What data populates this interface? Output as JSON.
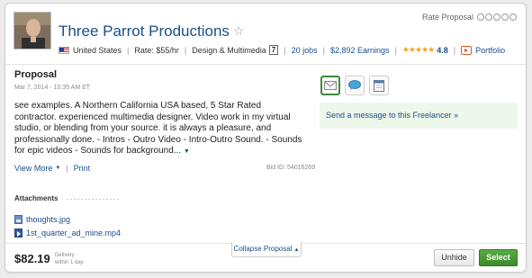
{
  "freelancer": {
    "name": "Three Parrot Productions",
    "country": "United States",
    "rate": "Rate: $55/hr",
    "category": "Design & Multimedia",
    "category_badge": "7",
    "jobs": "20 jobs",
    "earnings": "$2,892 Earnings",
    "stars": "★★★★★",
    "rating": "4.8",
    "portfolio_label": "Portfolio"
  },
  "rate_proposal": {
    "label": "Rate Proposal",
    "circles": 5
  },
  "proposal": {
    "title": "Proposal",
    "date": "Mar 7, 2014 - 10:35 AM ET",
    "text": "see examples. A Northern California USA based, 5 Star Rated contractor. experienced multimedia designer. Video work in my virtual studio, or blending from your source. it is always a pleasure, and professionally done. - Intros - Outro Video - Intro-Outro Sound. - Sounds for epic videos - Sounds for background...",
    "expand_caret": "▼",
    "view_more": "View More",
    "print": "Print",
    "bid_id": "Bid ID: 54016269"
  },
  "actions": {
    "send_message": "Send a message to this Freelancer »"
  },
  "attachments": {
    "title": "Attachments",
    "files": [
      {
        "name": "thoughts.jpg",
        "icon": "image-file-icon"
      },
      {
        "name": "1st_quarter_ad_mine.mp4",
        "icon": "video-file-icon"
      }
    ]
  },
  "footer": {
    "price": "$82.19",
    "delivery_label": "Delivery",
    "delivery_value": "within 1 day",
    "collapse_label": "Collapse Proposal",
    "unhide_label": "Unhide",
    "select_label": "Select"
  },
  "colors": {
    "link": "#1a4f8a",
    "accent_green": "#3d8a2b",
    "highlight_bg": "#edf7ea",
    "star": "#f2a11a"
  }
}
